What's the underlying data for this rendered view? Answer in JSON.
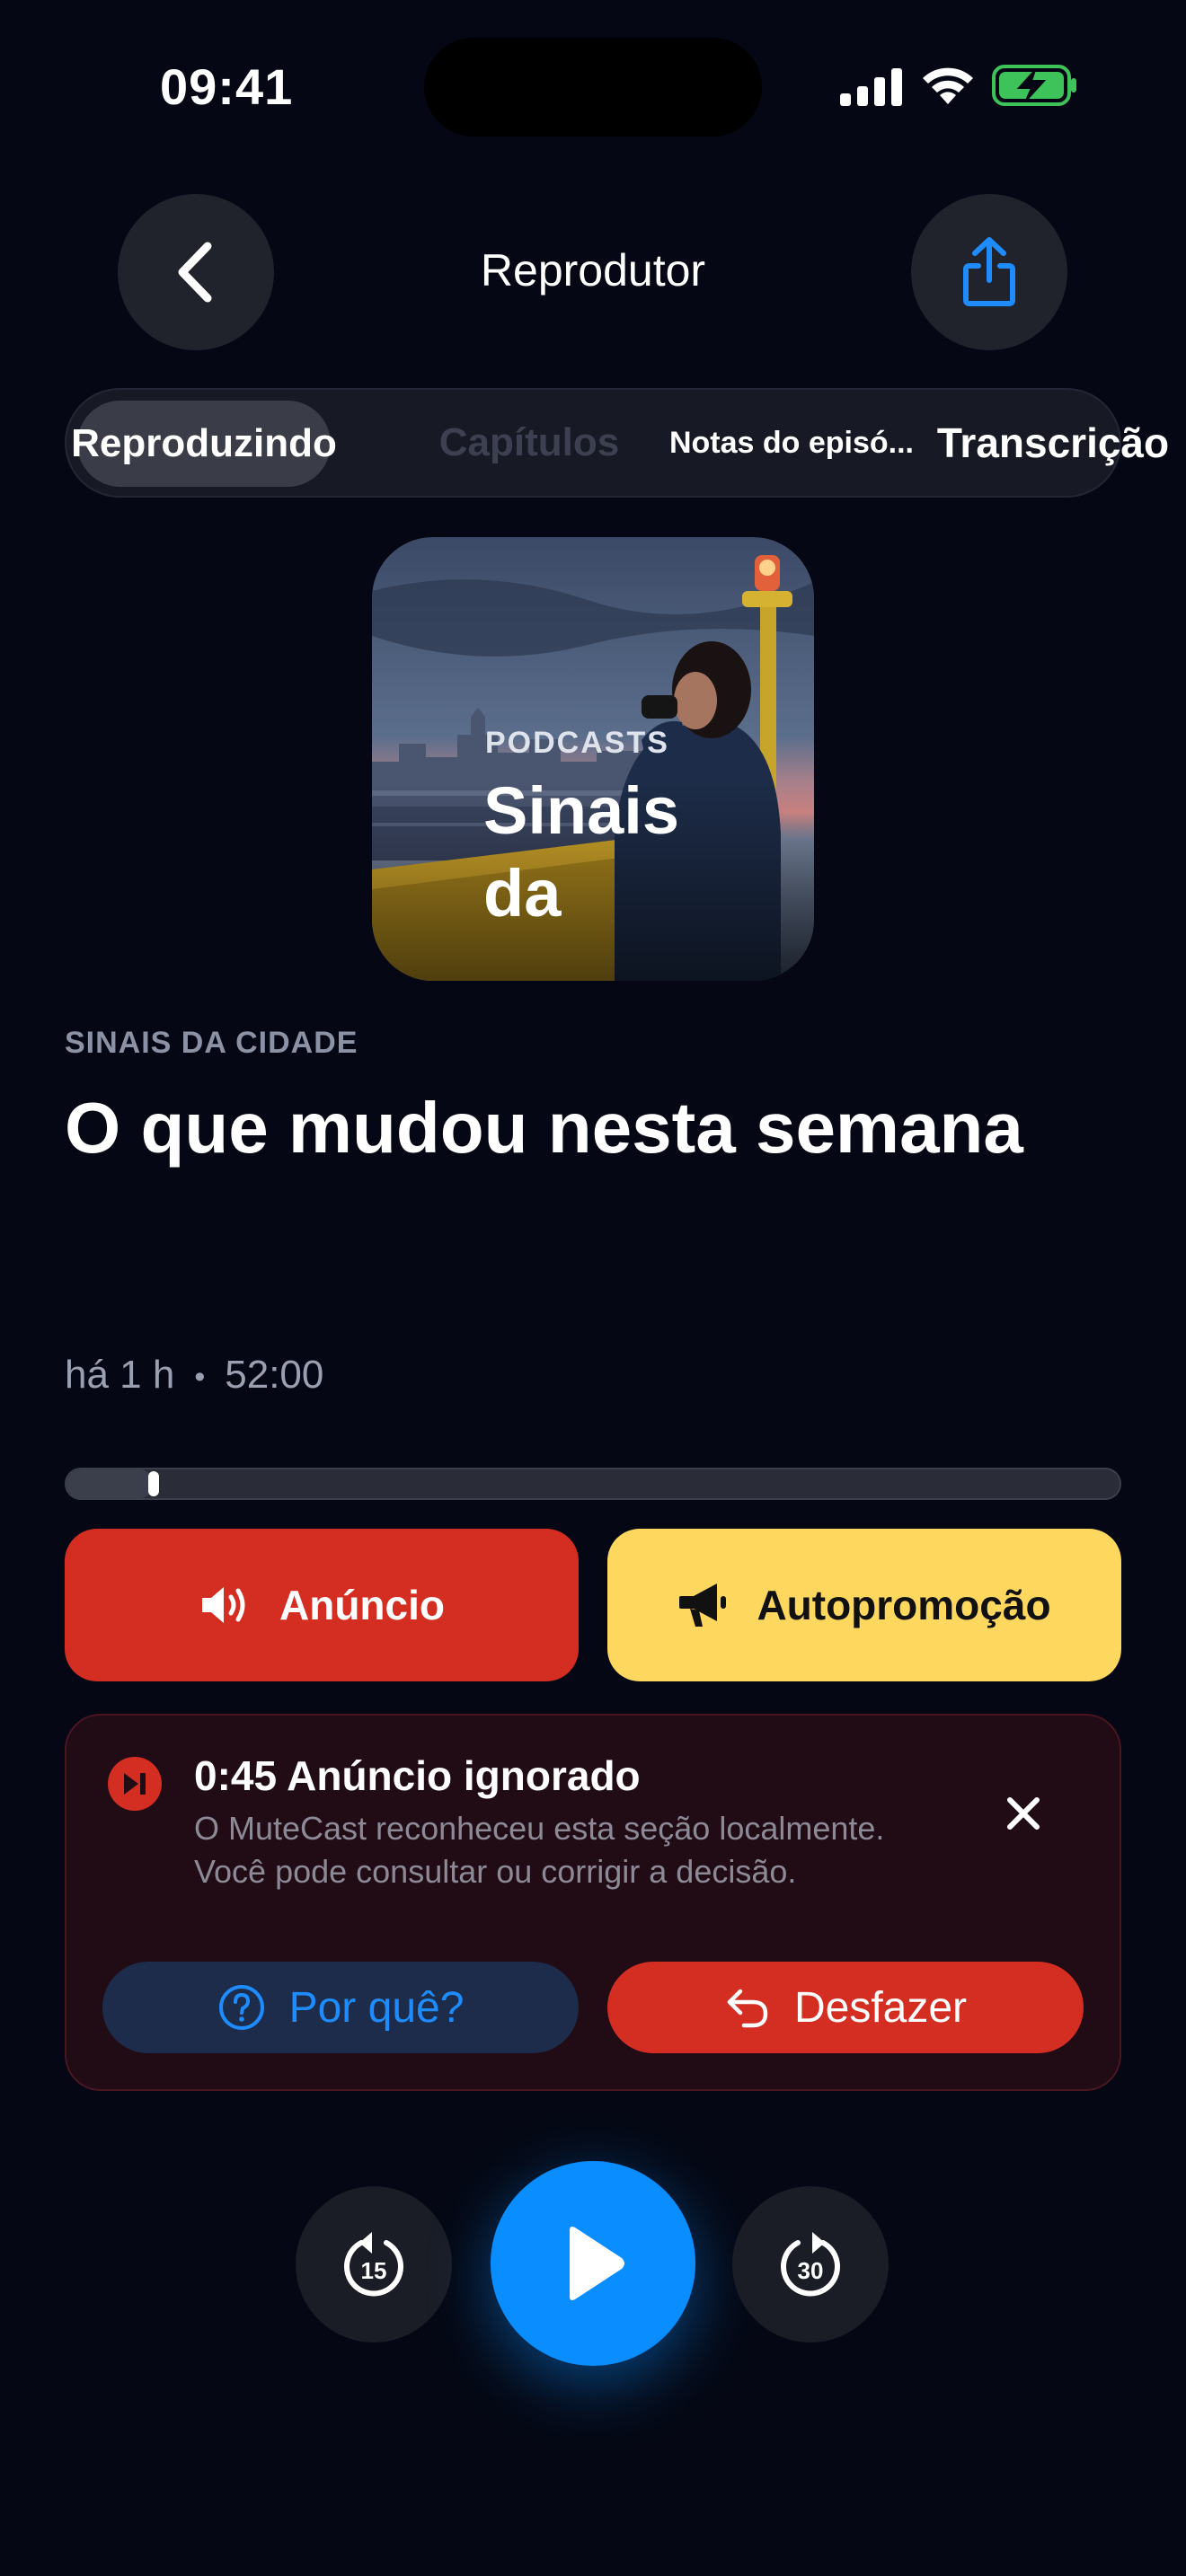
{
  "status_bar": {
    "time": "09:41"
  },
  "header": {
    "title": "Reprodutor",
    "back_icon": "chevron-left-icon",
    "share_icon": "share-icon"
  },
  "tabs": [
    {
      "label": "Reproduzindo",
      "active": true
    },
    {
      "label": "Capítulos",
      "active": false
    },
    {
      "label": "Notas do episó...",
      "active": false
    },
    {
      "label": "Transcrição",
      "active": false
    }
  ],
  "artwork": {
    "kicker": "PODCASTS",
    "line1": "Sinais",
    "line2": "da"
  },
  "episode": {
    "show": "SINAIS DA CIDADE",
    "title": "O que mudou nesta semana",
    "published": "há 1 h",
    "separator": "•",
    "duration": "52:00"
  },
  "progress": {
    "fraction": 0.083
  },
  "segments": {
    "ad_label": "Anúncio",
    "promo_label": "Autopromoção",
    "ad_color": "#d42e22",
    "promo_color": "#fdd75e"
  },
  "skip_card": {
    "title": "0:45 Anúncio ignorado",
    "description": "O MuteCast reconheceu esta seção localmente. Você pode consultar ou corrigir a decisão.",
    "why_label": "Por quê?",
    "undo_label": "Desfazer"
  },
  "controls": {
    "rewind_seconds": "15",
    "forward_seconds": "30",
    "accent": "#0a8dff"
  }
}
